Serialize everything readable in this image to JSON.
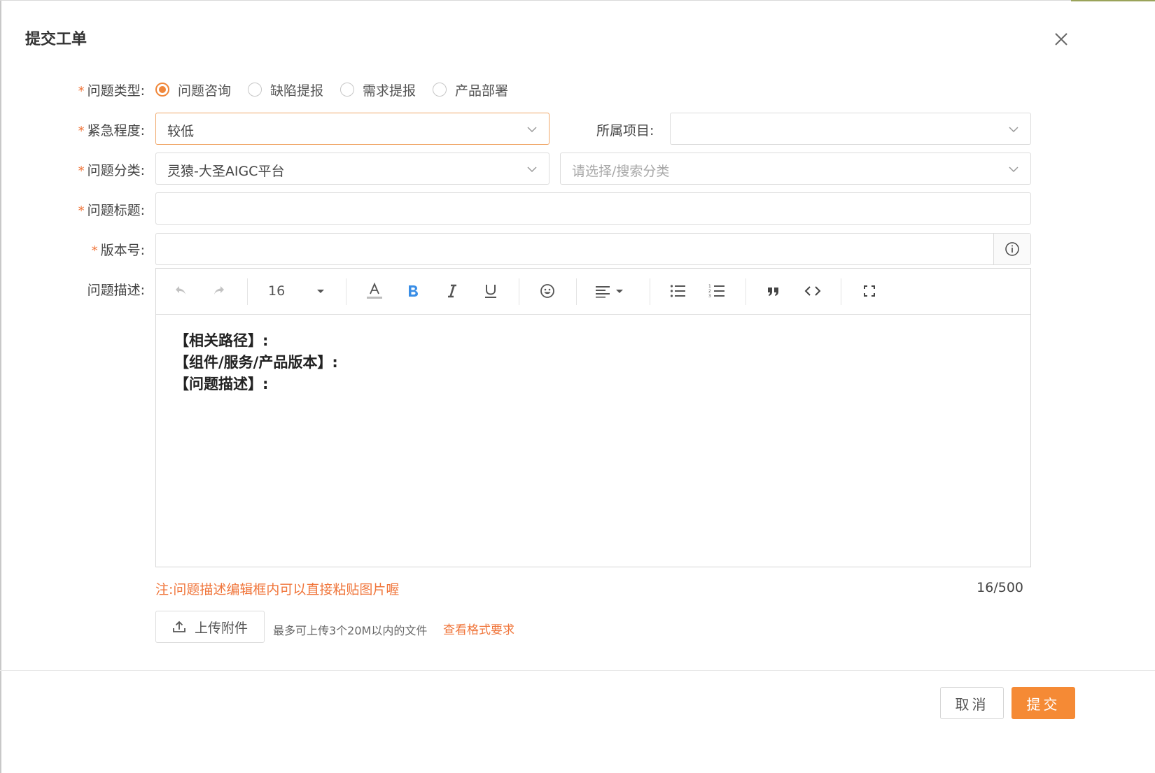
{
  "dialog": {
    "title": "提交工单"
  },
  "form": {
    "issue_type": {
      "label": "问题类型:",
      "options": [
        "问题咨询",
        "缺陷提报",
        "需求提报",
        "产品部署"
      ],
      "selected": "问题咨询"
    },
    "urgency": {
      "label": "紧急程度:",
      "value": "较低"
    },
    "project": {
      "label": "所属项目:",
      "value": ""
    },
    "category": {
      "label": "问题分类:",
      "value": "灵猿-大圣AIGC平台",
      "sub_placeholder": "请选择/搜索分类"
    },
    "title": {
      "label": "问题标题:",
      "value": ""
    },
    "version": {
      "label": "版本号:",
      "value": ""
    },
    "description": {
      "label": "问题描述:",
      "font_size": "16",
      "lines": [
        "【相关路径】:",
        "【组件/服务/产品版本】:",
        "【问题描述】:"
      ]
    },
    "required_mark": "*"
  },
  "note": "注:问题描述编辑框内可以直接粘贴图片喔",
  "char_count": "16/500",
  "upload": {
    "button_label": "上传附件",
    "hint": "最多可上传3个20M以内的文件",
    "format_link": "查看格式要求"
  },
  "footer": {
    "cancel_label": "取消",
    "submit_label": "提交"
  },
  "colors": {
    "accent": "#f58a35",
    "required": "#f0753a"
  }
}
